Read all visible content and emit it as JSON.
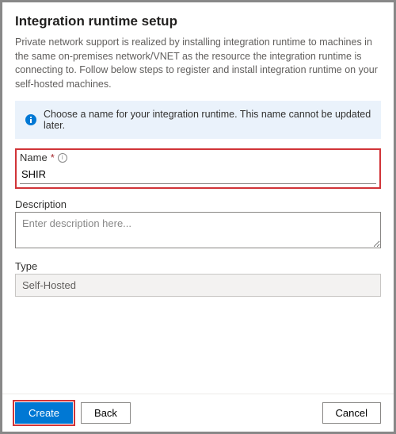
{
  "header": {
    "title": "Integration runtime setup",
    "intro": "Private network support is realized by installing integration runtime to machines in the same on-premises network/VNET as the resource the integration runtime is connecting to. Follow below steps to register and install integration runtime on your self-hosted machines."
  },
  "banner": {
    "text": "Choose a name for your integration runtime. This name cannot be updated later."
  },
  "fields": {
    "name": {
      "label": "Name",
      "value": "SHIR"
    },
    "description": {
      "label": "Description",
      "placeholder": "Enter description here...",
      "value": ""
    },
    "type": {
      "label": "Type",
      "value": "Self-Hosted"
    }
  },
  "buttons": {
    "create": "Create",
    "back": "Back",
    "cancel": "Cancel"
  },
  "colors": {
    "primary": "#0078d4",
    "highlight": "#d13438",
    "banner_bg": "#eaf2fb"
  }
}
